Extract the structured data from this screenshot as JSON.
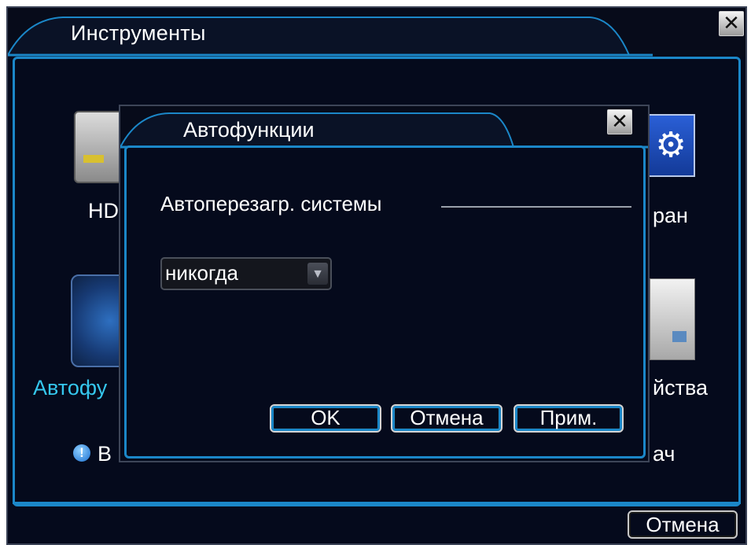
{
  "outer": {
    "title": "Инструменты",
    "close_glyph": "✕",
    "tools": {
      "hdd_label": "HD",
      "display_label": "ран",
      "auto_label": "Автофу",
      "info_label": "йства",
      "version_label": "В",
      "transfer_label": "ач"
    },
    "cancel_label": "Отмена"
  },
  "dialog": {
    "title": "Автофункции",
    "close_glyph": "✕",
    "group_label": "Автоперезагр. системы",
    "select_value": "никогда",
    "select_arrow": "▼",
    "ok_label": "OK",
    "cancel_label": "Отмена",
    "apply_label": "Прим."
  },
  "colors": {
    "background": "#050a1c",
    "accent_border": "#1b87c8",
    "active_label": "#35c7ee",
    "text": "#ffffff"
  },
  "icons": [
    "hdd-icon",
    "refresh-icon",
    "gear-icon",
    "document-icon",
    "info-icon",
    "close-icon",
    "chevron-down-icon"
  ]
}
